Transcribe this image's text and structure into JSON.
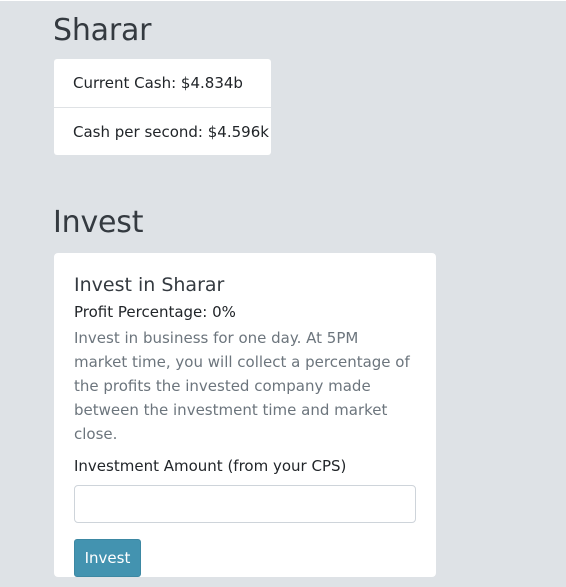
{
  "company": {
    "name": "Sharar"
  },
  "stats": {
    "current_cash": "Current Cash: $4.834b",
    "cash_per_second": "Cash per second: $4.596k"
  },
  "invest": {
    "heading": "Invest",
    "card_title": "Invest in Sharar",
    "profit_percentage": "Profit Percentage: 0%",
    "description": "Invest in business for one day. At 5PM market time, you will collect a percentage of the profits the invested company made between the investment time and market close.",
    "amount_label": "Investment Amount (from your CPS)",
    "amount_value": "",
    "button_label": "Invest",
    "button_color": "#4393b0"
  }
}
